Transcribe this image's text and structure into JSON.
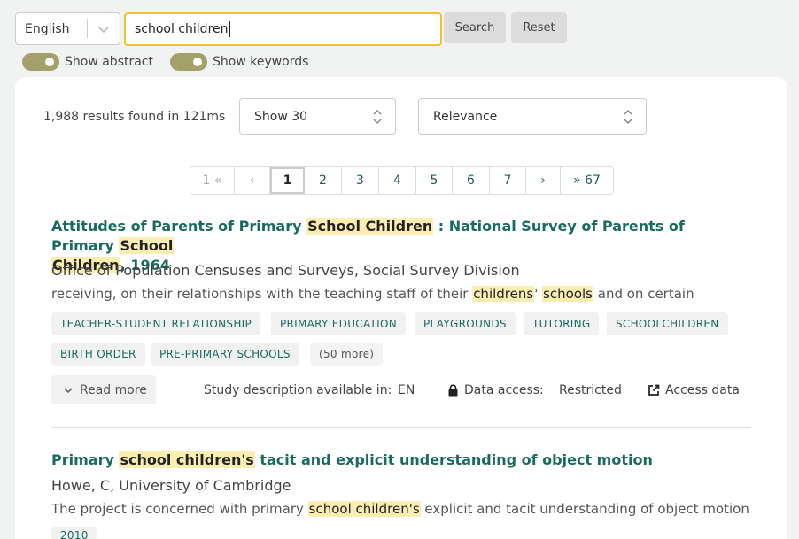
{
  "search": {
    "language": "English",
    "query": "school children",
    "search_label": "Search",
    "reset_label": "Reset",
    "toggle_abstract_label": "Show abstract",
    "toggle_keywords_label": "Show keywords"
  },
  "results_bar": {
    "count_text": "1,988 results found in 121ms",
    "page_size": "Show 30",
    "sort": "Relevance"
  },
  "pagination": {
    "first": "1 «",
    "prev": "‹",
    "pages": [
      "1",
      "2",
      "3",
      "4",
      "5",
      "6",
      "7"
    ],
    "current": "1",
    "next": "›",
    "last": "» 67"
  },
  "results": [
    {
      "title_parts": {
        "p1": "Attitudes of Parents of Primary ",
        "h1": "School Children",
        "p2": " : National Survey of Parents of Primary ",
        "h2": "School",
        "h3": "Children",
        "p3": ", 1964"
      },
      "creator": "Office of Population Censuses and Surveys, Social Survey Division",
      "abstract_parts": {
        "p1": "receiving, on their relationships with the teaching staff of their ",
        "h1": "childrens",
        "p2": "' ",
        "h2": "schools",
        "p3": " and on certain"
      },
      "keywords": [
        "TEACHER-STUDENT RELATIONSHIP",
        "PRIMARY EDUCATION",
        "PLAYGROUNDS",
        "TUTORING",
        "SCHOOLCHILDREN",
        "BIRTH ORDER",
        "PRE-PRIMARY SCHOOLS"
      ],
      "more_keywords": "(50 more)",
      "read_more": "Read more",
      "study_desc_label": "Study description available in:",
      "study_desc_lang": "EN",
      "data_access_label": "Data access:",
      "data_access_value": "Restricted",
      "access_link": "Access data"
    },
    {
      "title_parts": {
        "p1": "Primary ",
        "h1": "school children's",
        "p2": " tacit and explicit understanding of object motion"
      },
      "creator": "Howe, C, University of Cambridge",
      "abstract_parts": {
        "p1": "The project is concerned with primary ",
        "h1": "school children's",
        "p2": " explicit and tacit understanding of object motion"
      },
      "year_tag": "2010"
    }
  ],
  "icons": {
    "dropdown": "chevron-down-icon",
    "sort": "updown-chevron-icon",
    "lock": "lock-icon",
    "external": "external-link-icon"
  },
  "colors": {
    "accent": "#1a6b5f",
    "highlight": "#fbeeb0",
    "focus_border": "#f0c22d",
    "toggle": "#a3a06a"
  }
}
